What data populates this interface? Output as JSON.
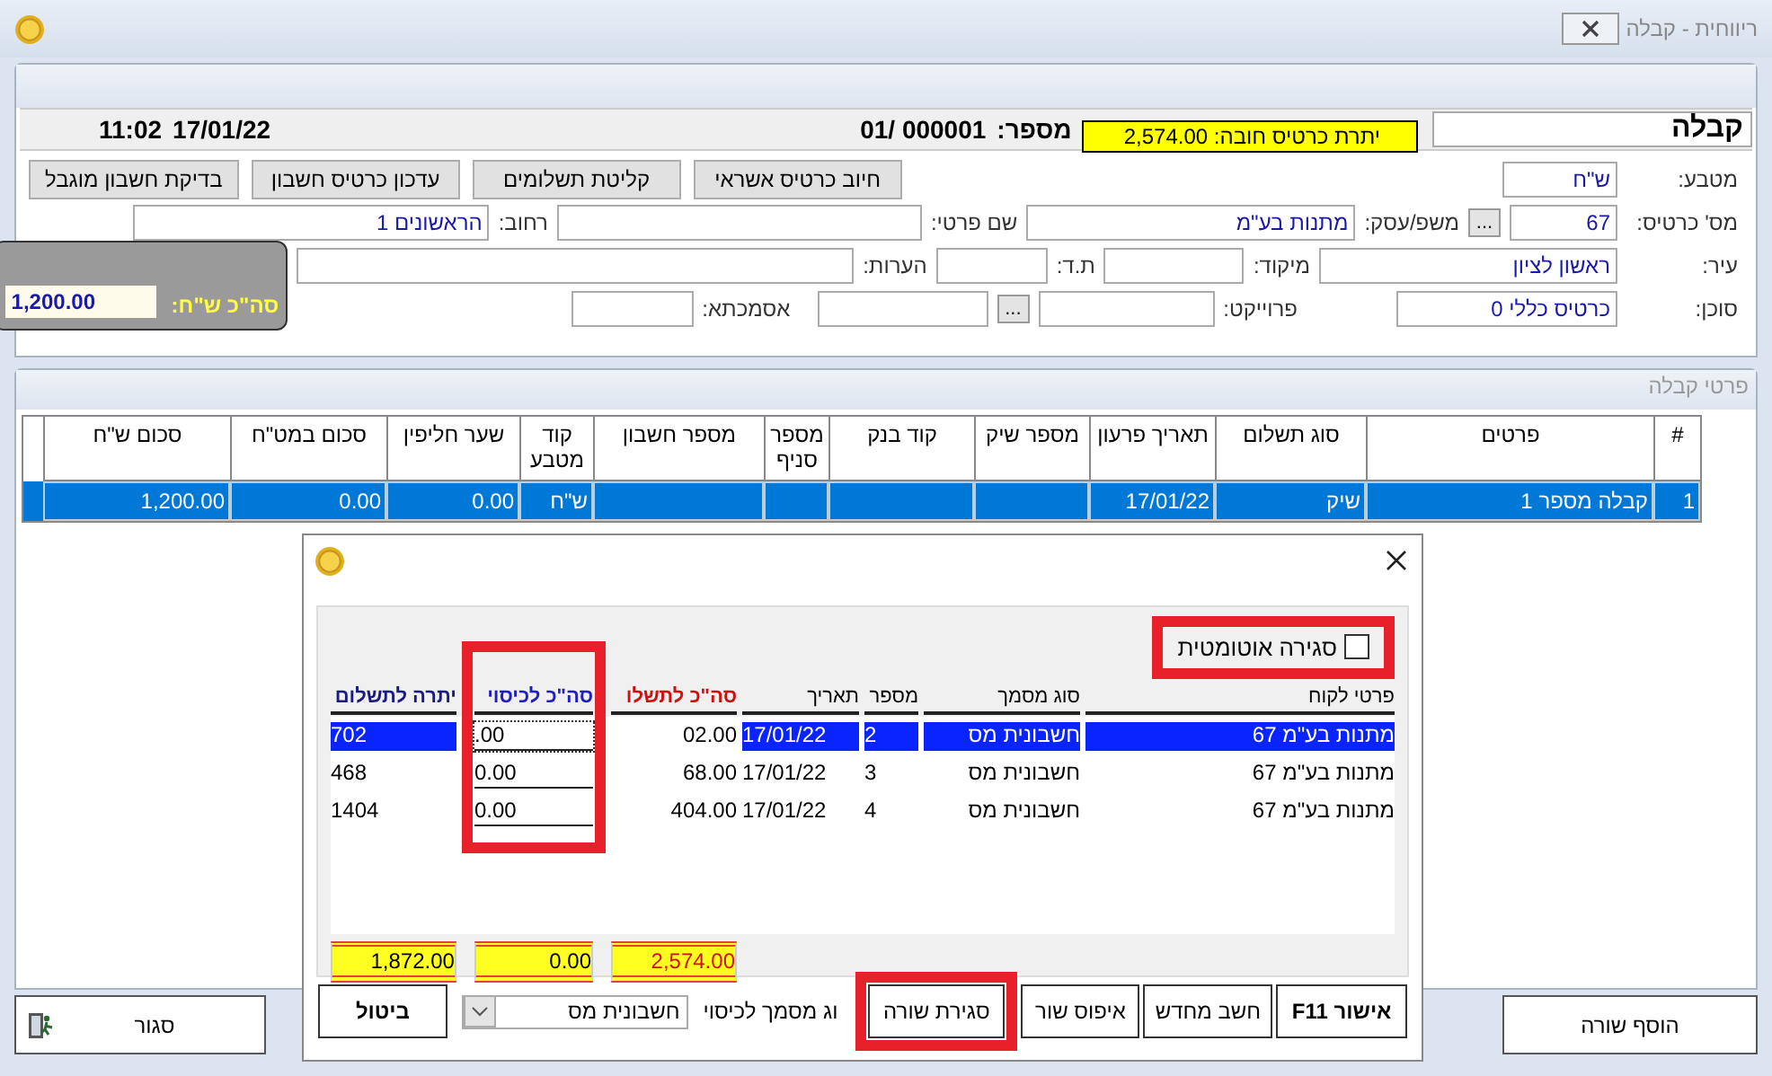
{
  "window": {
    "title": "ריווחית - קבלה"
  },
  "header": {
    "doc_type": "קבלה",
    "balance_label": "יתרת כרטיס חובה:",
    "balance": "2,574.00",
    "number_label": "מספר:",
    "number": "01/ 000001",
    "date": "17/01/22",
    "time": "11:02"
  },
  "actions": [
    "חיוב כרטיס אשראי",
    "קליטת תשלומים",
    "עדכון כרטיס חשבון",
    "בדיקת חשבון מוגבל"
  ],
  "currency": {
    "label": "מטבע:",
    "value": "ש\"ח"
  },
  "card_no": {
    "label": "מס' כרטיס:",
    "value": "67",
    "browse": "..."
  },
  "business": {
    "label": "משפ/עסק:",
    "value": "מתנות בע\"מ"
  },
  "first_name": {
    "label": "שם פרטי:"
  },
  "street": {
    "label": "רחוב:",
    "value": "הראשונים 1"
  },
  "city": {
    "label": "עיר:",
    "value": "ראשון לציון"
  },
  "zip": {
    "label": "מיקוד:"
  },
  "po_box": {
    "label": "ת.ד:"
  },
  "notes": {
    "label": "הערות:"
  },
  "agent": {
    "label": "סוכן:",
    "value": "כרטיס כללי 0"
  },
  "project": {
    "label": "פרוייקט:",
    "browse": "..."
  },
  "reference": {
    "label": "אסמכתא:"
  },
  "total": {
    "label": "סה\"כ ש\"ח:",
    "value": "1,200.00"
  },
  "details": {
    "title": "פרטי קבלה",
    "columns": [
      "#",
      "פרטים",
      "סוג תשלום",
      "תאריך פרעון",
      "מספר שיק",
      "קוד בנק",
      "מספר סניף",
      "מספר חשבון",
      "קוד מטבע",
      "שער חליפין",
      "סכום במט\"ח",
      "סכום ש\"ח"
    ],
    "rows": [
      {
        "cells": [
          "1",
          "קבלה מספר 1",
          "שיק",
          "17/01/22",
          "",
          "",
          "",
          "",
          "ש\"ח",
          "0.00",
          "0.00",
          "1,200.00"
        ],
        "selected": true
      }
    ]
  },
  "add_row": "הוסף שורה",
  "close": "סגור",
  "dialog": {
    "auto_close": {
      "label": "סגירה אוטומטית",
      "checked": false
    },
    "columns": [
      "פרטי לקוח",
      "סוג מסמך",
      "מספר",
      "תאריך",
      "סה\"כ לתשלו",
      "סה\"כ לכיסוי",
      "יתרה לתשלום"
    ],
    "rows": [
      {
        "customer": "מתנות בע\"מ  67",
        "doc_type": "חשבונית מס",
        "number": "2",
        "date": "17/01/22",
        "due": "02.00",
        "cover": ".00",
        "balance": "702",
        "selected": true
      },
      {
        "customer": "מתנות בע\"מ  67",
        "doc_type": "חשבונית מס",
        "number": "3",
        "date": "17/01/22",
        "due": "68.00",
        "cover": "0.00",
        "balance": "468",
        "selected": false
      },
      {
        "customer": "מתנות בע\"מ  67",
        "doc_type": "חשבונית מס",
        "number": "4",
        "date": "17/01/22",
        "due": "404.00",
        "cover": "0.00",
        "balance": "1404",
        "selected": false
      }
    ],
    "totals": {
      "due": "2,574.00",
      "cover": "0.00",
      "balance": "1,872.00"
    },
    "confirm": "אישור F11",
    "recalc": "חשב מחדש",
    "reset_row": "איפוס שור",
    "close_row": "סגירת שורה",
    "cover_type_label": "וג מסמך לכיסוי",
    "cover_type": "חשבונית מס",
    "cancel": "ביטול"
  }
}
